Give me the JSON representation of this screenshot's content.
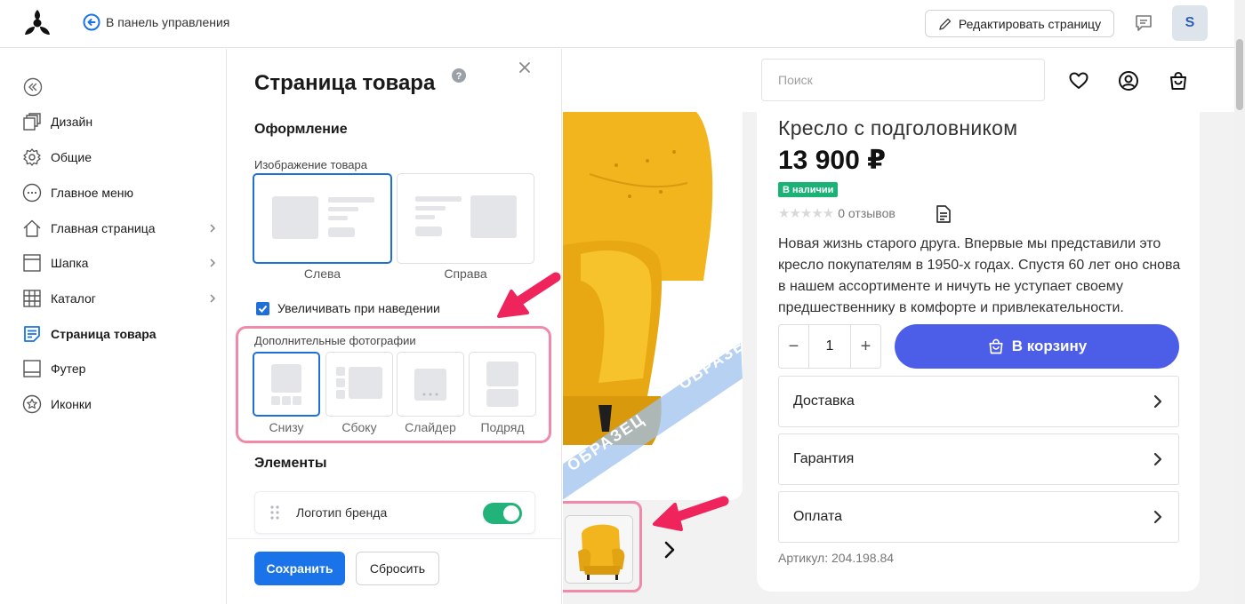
{
  "topbar": {
    "back_label": "В панель управления",
    "edit_label": "Редактировать страницу",
    "avatar_letter": "S"
  },
  "sidebar": {
    "items": [
      {
        "label": "Дизайн",
        "icon": "design-icon",
        "has_chevron": false,
        "active": false
      },
      {
        "label": "Общие",
        "icon": "gear-icon",
        "has_chevron": false,
        "active": false
      },
      {
        "label": "Главное меню",
        "icon": "menu-dots-icon",
        "has_chevron": false,
        "active": false
      },
      {
        "label": "Главная страница",
        "icon": "home-icon",
        "has_chevron": true,
        "active": false
      },
      {
        "label": "Шапка",
        "icon": "header-icon",
        "has_chevron": true,
        "active": false
      },
      {
        "label": "Каталог",
        "icon": "catalog-grid-icon",
        "has_chevron": true,
        "active": false
      },
      {
        "label": "Страница товара",
        "icon": "product-page-icon",
        "has_chevron": false,
        "active": true
      },
      {
        "label": "Футер",
        "icon": "footer-icon",
        "has_chevron": false,
        "active": false
      },
      {
        "label": "Иконки",
        "icon": "star-icon",
        "has_chevron": false,
        "active": false
      }
    ]
  },
  "panel": {
    "title": "Страница товара",
    "design_section": "Оформление",
    "image_label": "Изображение товара",
    "image_options": [
      {
        "label": "Слева",
        "selected": true
      },
      {
        "label": "Справа",
        "selected": false
      }
    ],
    "zoom_checkbox_label": "Увеличивать при наведении",
    "zoom_checked": true,
    "photos_label": "Дополнительные фотографии",
    "photo_options": [
      {
        "label": "Снизу",
        "selected": true
      },
      {
        "label": "Сбоку",
        "selected": false
      },
      {
        "label": "Слайдер",
        "selected": false
      },
      {
        "label": "Подряд",
        "selected": false
      }
    ],
    "elements_section": "Элементы",
    "element_rows": [
      {
        "label": "Логотип бренда",
        "enabled": true
      }
    ],
    "save_label": "Сохранить",
    "reset_label": "Сбросить"
  },
  "preview": {
    "search_placeholder": "Поиск",
    "watermark": "ОБРАЗЕЦ",
    "product": {
      "name": "Кресло с подголовником",
      "price": "13 900 ₽",
      "stock": "В наличии",
      "reviews": "0 отзывов",
      "rating": 0,
      "description": "Новая жизнь старого друга. Впервые мы представили это кресло покупателям в 1950-х годах. Спустя 60 лет оно снова в нашем ассортименте и ничуть не уступает своему предшественнику в комфорте и привлекательности.",
      "quantity": "1",
      "cart_label": "В корзину",
      "accordions": [
        "Доставка",
        "Гарантия",
        "Оплата"
      ],
      "sku": "Артикул: 204.198.84"
    }
  },
  "colors": {
    "accent_blue": "#1a73e8",
    "cart_button": "#4c5ee8",
    "in_stock": "#1bb276",
    "highlight_pink": "#f08aa8",
    "arrow_red": "#f0245c",
    "chair_yellow": "#f2b51e"
  }
}
